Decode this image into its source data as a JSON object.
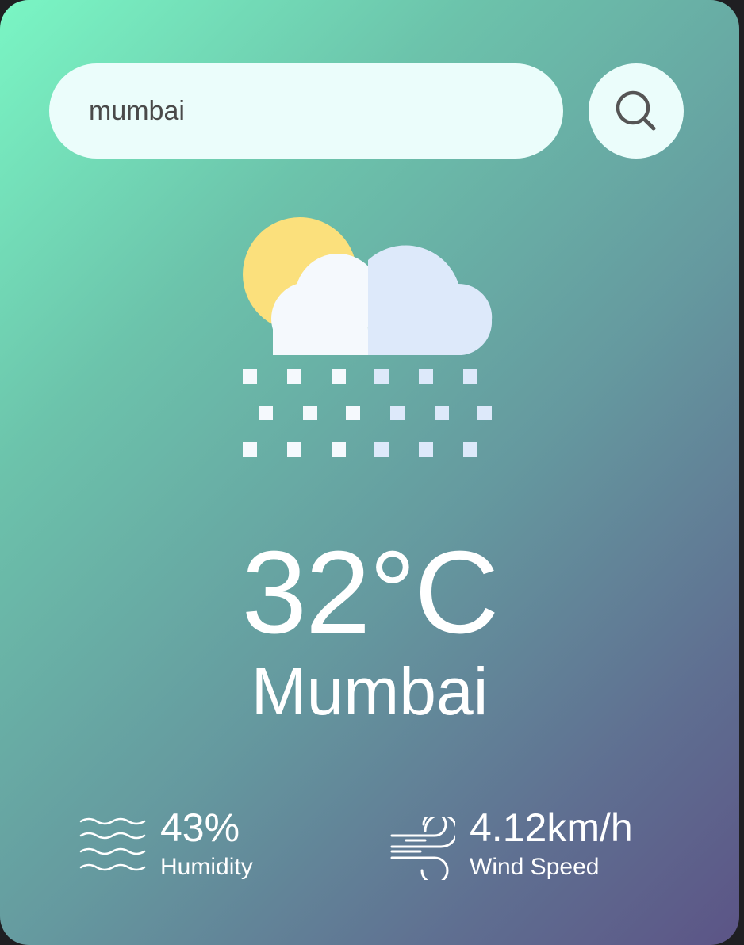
{
  "search": {
    "value": "mumbai",
    "button_icon": "search-icon"
  },
  "weather": {
    "icon": "partly-cloudy-snow-icon",
    "temperature": "32°C",
    "city": "Mumbai"
  },
  "stats": {
    "humidity": {
      "icon": "humidity-waves-icon",
      "value": "43%",
      "label": "Humidity"
    },
    "wind": {
      "icon": "wind-icon",
      "value": "4.12km/h",
      "label": "Wind Speed"
    }
  },
  "colors": {
    "gradient_start": "#7af6c4",
    "gradient_end": "#5c5486",
    "input_background": "#ebfdfb",
    "sun": "#fbe07c",
    "cloud_light": "#f5f9fd",
    "cloud_shade": "#dde9fa",
    "text": "#ffffff"
  }
}
